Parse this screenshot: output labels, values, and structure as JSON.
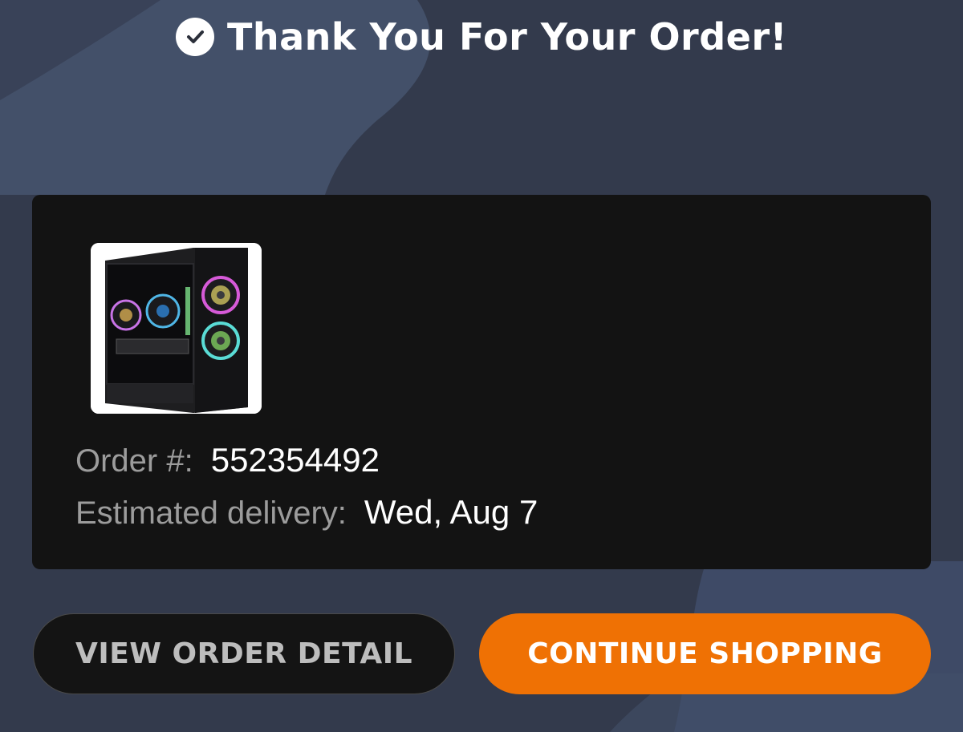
{
  "header": {
    "title": "Thank You For Your Order!",
    "icon": "check-circle-icon"
  },
  "order": {
    "product_image": "gaming-pc-tower",
    "order_label": "Order #:",
    "order_number": "552354492",
    "delivery_label": "Estimated delivery:",
    "delivery_date": "Wed, Aug 7"
  },
  "actions": {
    "view_order_label": "VIEW ORDER DETAIL",
    "continue_label": "CONTINUE SHOPPING"
  },
  "colors": {
    "background": "#333a4c",
    "background_accent": "#435069",
    "card": "#131313",
    "accent": "#ef7104"
  }
}
